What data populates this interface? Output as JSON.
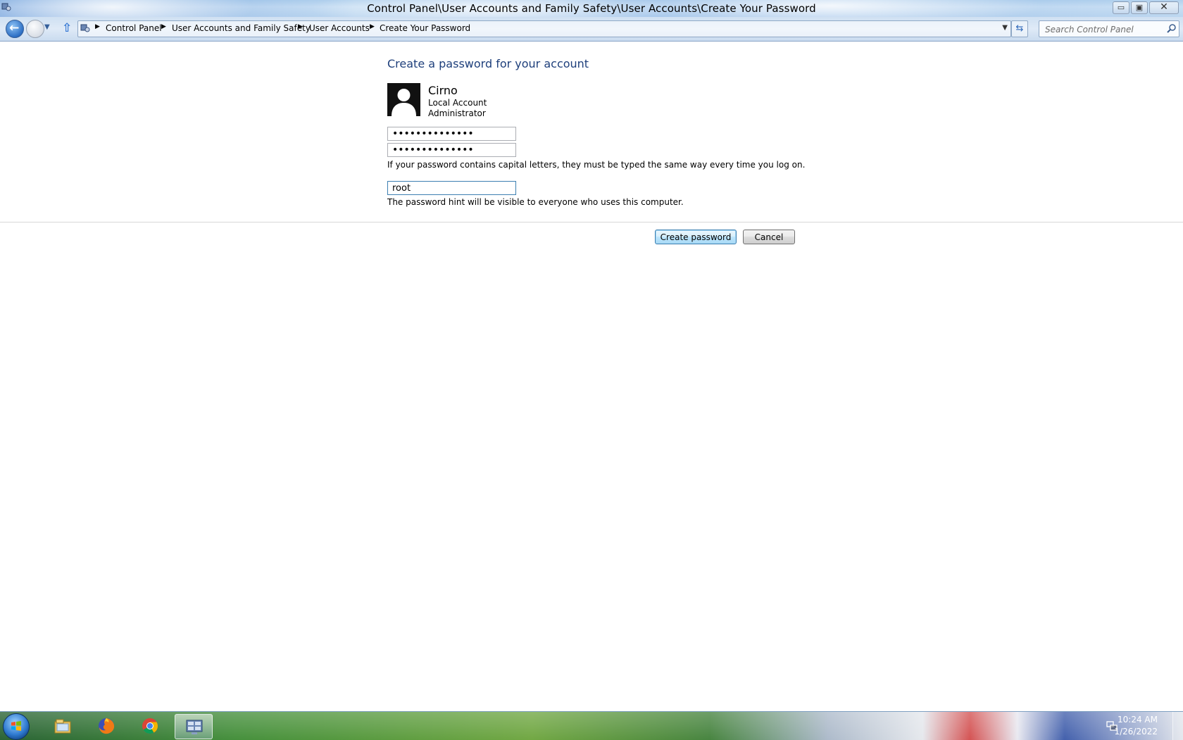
{
  "window": {
    "title": "Control Panel\\User Accounts and Family Safety\\User Accounts\\Create Your Password",
    "minimize_glyph": "▭",
    "restore_glyph": "▣",
    "close_glyph": "✕"
  },
  "nav": {
    "back_glyph": "←",
    "dropdown_glyph": "▼",
    "up_glyph": "⇧",
    "refresh_glyph": "⇆",
    "breadcrumbs": [
      "Control Panel",
      "User Accounts and Family Safety",
      "User Accounts",
      "Create Your Password"
    ],
    "separator_glyph": "▶",
    "address_drop_glyph": "▼"
  },
  "search": {
    "placeholder": "Search Control Panel"
  },
  "main": {
    "heading": "Create a password for your account",
    "account": {
      "name": "Cirno",
      "type": "Local Account",
      "role": "Administrator"
    },
    "new_password_value": "••••••••••••••",
    "confirm_password_value": "••••••••••••••",
    "capital_letters_note": "If your password contains capital letters, they must be typed the same way every time you log on.",
    "hint_value": "root",
    "hint_note": "The password hint will be visible to everyone who uses this computer.",
    "create_button": "Create password",
    "cancel_button": "Cancel"
  },
  "taskbar": {
    "apps": [
      "file-explorer-icon",
      "firefox-icon",
      "chrome-icon",
      "control-panel-icon"
    ],
    "time": "10:24 AM",
    "date": "1/26/2022"
  },
  "colors": {
    "heading": "#1e3f7b",
    "accent": "#3c7fb1"
  }
}
